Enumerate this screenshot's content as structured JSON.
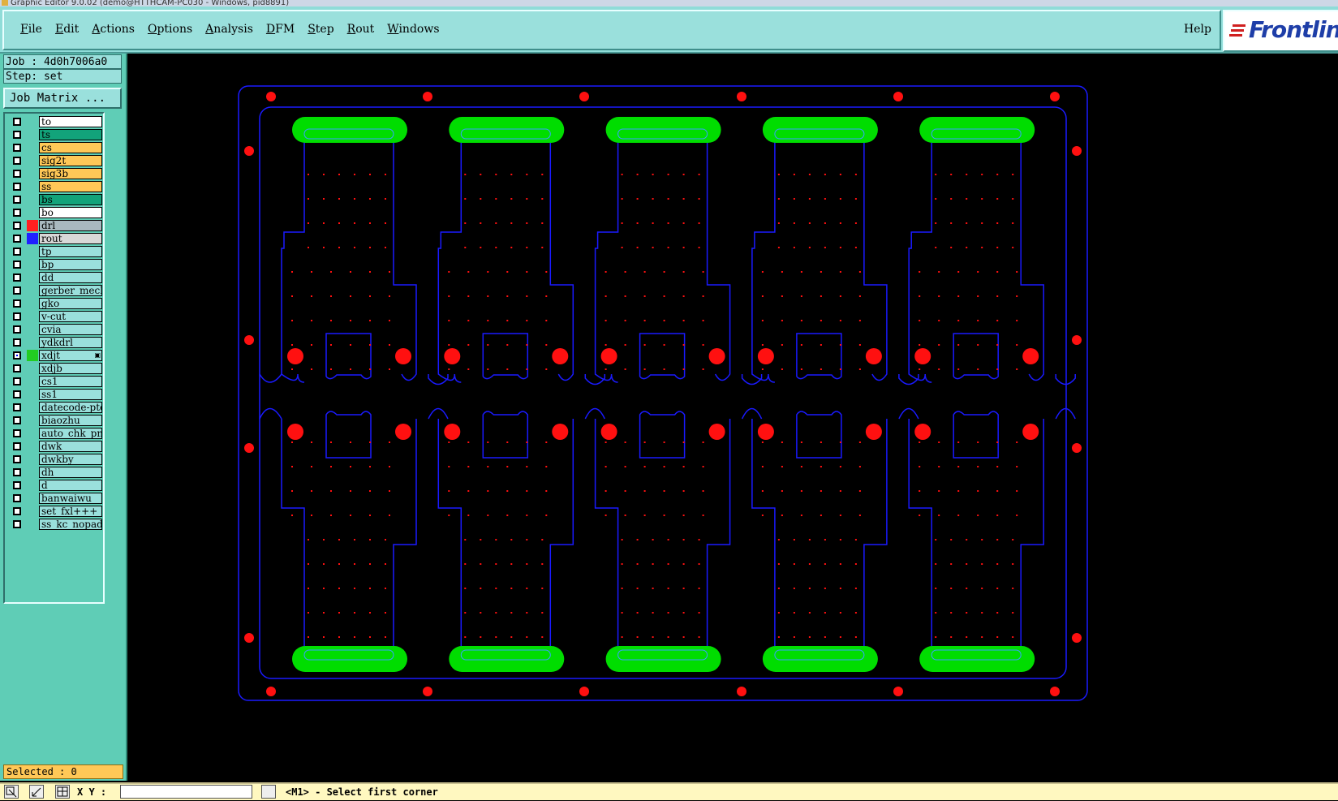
{
  "window": {
    "title": "Graphic Editor 9.0.02 (demo@HTTHCAM-PC030 - Windows, pid8891)"
  },
  "menu": {
    "items": [
      {
        "label": "File",
        "u": "F",
        "rest": "ile"
      },
      {
        "label": "Edit",
        "u": "E",
        "rest": "dit"
      },
      {
        "label": "Actions",
        "u": "A",
        "rest": "ctions"
      },
      {
        "label": "Options",
        "u": "O",
        "rest": "ptions"
      },
      {
        "label": "Analysis",
        "u": "A",
        "rest": "nalysis"
      },
      {
        "label": "DFM",
        "u": "D",
        "rest": "FM"
      },
      {
        "label": "Step",
        "u": "S",
        "rest": "tep"
      },
      {
        "label": "Rout",
        "u": "R",
        "rest": "out"
      },
      {
        "label": "Windows",
        "u": "W",
        "rest": "indows"
      }
    ],
    "help": "Help"
  },
  "logo": {
    "text": "Frontlin"
  },
  "job": {
    "label": "Job : 4d0h7006a0",
    "step": "Step: set",
    "matrix_button": "Job Matrix ..."
  },
  "layers": {
    "board": [
      {
        "name": "to",
        "bg": "#ffffff",
        "sw": ""
      },
      {
        "name": "ts",
        "bg": "#12a37a",
        "sw": ""
      },
      {
        "name": "cs",
        "bg": "#ffc857",
        "sw": ""
      },
      {
        "name": "sig2t",
        "bg": "#ffc857",
        "sw": ""
      },
      {
        "name": "sig3b",
        "bg": "#ffc857",
        "sw": ""
      },
      {
        "name": "ss",
        "bg": "#ffc857",
        "sw": ""
      },
      {
        "name": "bs",
        "bg": "#12a37a",
        "sw": ""
      },
      {
        "name": "bo",
        "bg": "#ffffff",
        "sw": ""
      }
    ],
    "drill": [
      {
        "name": "drl",
        "bg": "#a9b9c0",
        "sw": "#ff2020"
      },
      {
        "name": "rout",
        "bg": "#d8d8d8",
        "sw": "#2020ff"
      }
    ],
    "misc": [
      {
        "name": "tp",
        "bg": "#9ae0dc",
        "sw": ""
      },
      {
        "name": "bp",
        "bg": "#9ae0dc",
        "sw": ""
      },
      {
        "name": "dd",
        "bg": "#9ae0dc",
        "sw": ""
      },
      {
        "name": "gerber_mecha",
        "bg": "#9ae0dc",
        "sw": ""
      },
      {
        "name": "gko",
        "bg": "#9ae0dc",
        "sw": ""
      },
      {
        "name": "v-cut",
        "bg": "#9ae0dc",
        "sw": ""
      },
      {
        "name": "cvia",
        "bg": "#9ae0dc",
        "sw": ""
      },
      {
        "name": "ydkdrl",
        "bg": "#9ae0dc",
        "sw": ""
      },
      {
        "name": "xdjt",
        "bg": "#9ae0dc",
        "sw": "#22cc22",
        "selected": true
      },
      {
        "name": "xdjb",
        "bg": "#9ae0dc",
        "sw": ""
      },
      {
        "name": "cs1",
        "bg": "#9ae0dc",
        "sw": ""
      },
      {
        "name": "ss1",
        "bg": "#9ae0dc",
        "sw": ""
      },
      {
        "name": "datecode-pte",
        "bg": "#9ae0dc",
        "sw": ""
      },
      {
        "name": "biaozhu",
        "bg": "#9ae0dc",
        "sw": ""
      },
      {
        "name": "auto_chk_pni",
        "bg": "#9ae0dc",
        "sw": ""
      },
      {
        "name": "dwk",
        "bg": "#9ae0dc",
        "sw": ""
      },
      {
        "name": "dwkby",
        "bg": "#9ae0dc",
        "sw": ""
      },
      {
        "name": "dh",
        "bg": "#9ae0dc",
        "sw": ""
      },
      {
        "name": "d",
        "bg": "#9ae0dc",
        "sw": ""
      },
      {
        "name": "banwaiwu",
        "bg": "#9ae0dc",
        "sw": ""
      },
      {
        "name": "set_fxl+++",
        "bg": "#9ae0dc",
        "sw": ""
      },
      {
        "name": "ss_kc_nopad",
        "bg": "#9ae0dc",
        "sw": ""
      }
    ]
  },
  "selected": "Selected : 0",
  "status": {
    "xy_label": "X Y :",
    "prompt": "<M1> - Select first corner"
  },
  "colors": {
    "rout": "#1a1aff",
    "pad": "#00dd00",
    "drill": "#ff1010",
    "outline": "#3a52ff"
  },
  "icons": {
    "tool1": "zoom-window-icon",
    "tool2": "zoom-out-icon",
    "tool3": "grid-icon"
  }
}
